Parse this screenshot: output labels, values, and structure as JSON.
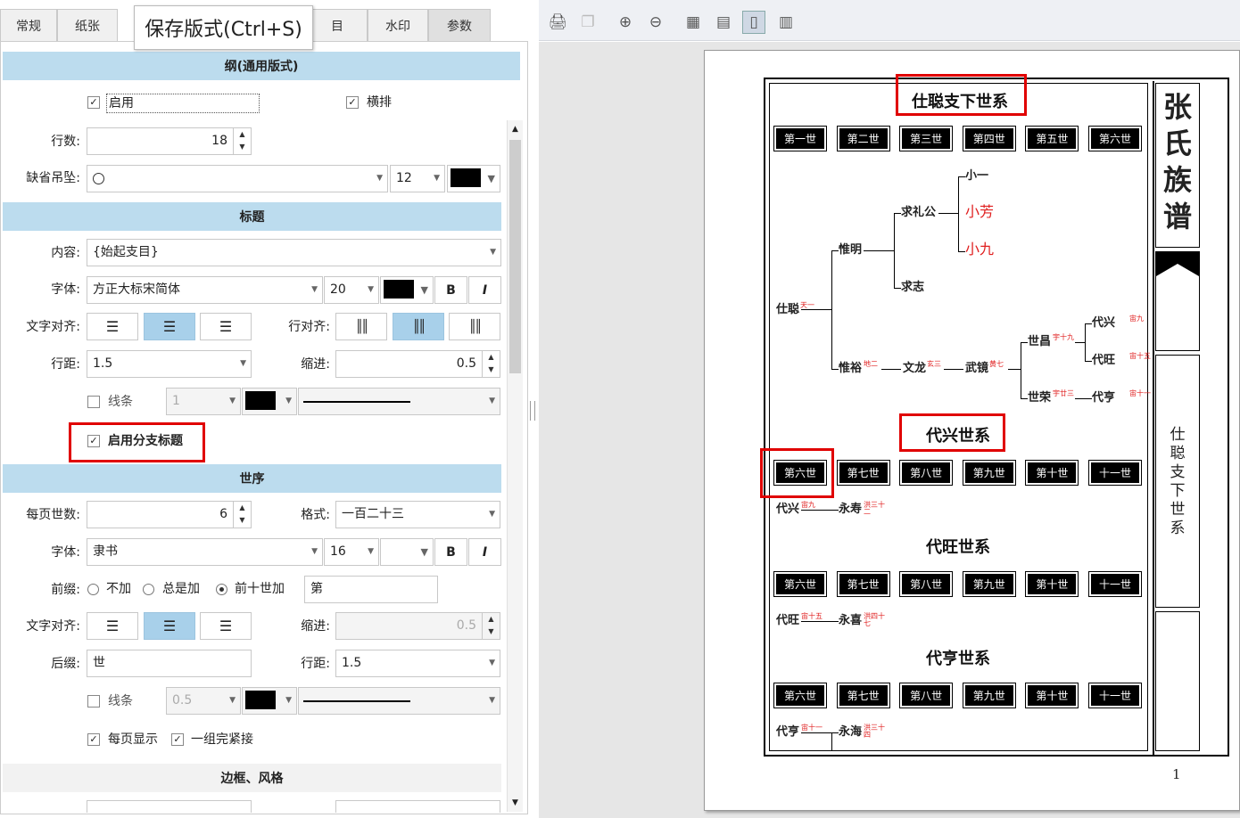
{
  "tabs": [
    {
      "label": "常规"
    },
    {
      "label": "纸张"
    },
    {
      "label": "目"
    },
    {
      "label": "水印"
    },
    {
      "label": "参数"
    }
  ],
  "tooltip": "保存版式(Ctrl+S)",
  "s1": {
    "title": "纲(通用版式)",
    "enable": "启用",
    "horizontal": "横排",
    "rows_label": "行数:",
    "rows": "18",
    "pendant_label": "缺省吊坠:",
    "pendant_size": "12"
  },
  "s2": {
    "title": "标题",
    "content_label": "内容:",
    "content": "{始起支目}",
    "font_label": "字体:",
    "font": "方正大标宋简体",
    "size": "20",
    "bold": "B",
    "italic": "I",
    "align_label": "文字对齐:",
    "row_align_label": "行对齐:",
    "spacing_label": "行距:",
    "spacing": "1.5",
    "indent_label": "缩进:",
    "indent": "0.5",
    "line_label": "线条",
    "line_value": "1",
    "branch_title": "启用分支标题"
  },
  "s3": {
    "title": "世序",
    "per_page_label": "每页世数:",
    "per_page": "6",
    "format_label": "格式:",
    "format": "一百二十三",
    "font_label": "字体:",
    "font": "隶书",
    "size": "16",
    "bold": "B",
    "italic": "I",
    "prefix_label": "前缀:",
    "opt_none": "不加",
    "opt_always": "总是加",
    "opt_first10": "前十世加",
    "prefix": "第",
    "align_label": "文字对齐:",
    "indent_label": "缩进:",
    "indent": "0.5",
    "suffix_label": "后缀:",
    "suffix": "世",
    "spacing_label": "行距:",
    "spacing": "1.5",
    "line_label": "线条",
    "line_value": "0.5",
    "show_each": "每页显示",
    "compact": "一组完紧接"
  },
  "s4": {
    "title": "边框、风格"
  },
  "doc": {
    "side_title": [
      "张",
      "氏",
      "族",
      "谱"
    ],
    "side_sub": [
      "仕",
      "聪",
      "支",
      "下",
      "世",
      "系"
    ],
    "page_num": "1",
    "sec1": "仕聪支下世系",
    "gens1": [
      "第一世",
      "第二世",
      "第三世",
      "第四世",
      "第五世",
      "第六世"
    ],
    "gens_b": [
      "第六世",
      "第七世",
      "第八世",
      "第九世",
      "第十世",
      "十一世"
    ],
    "sec2": "代兴世系",
    "sec3": "代旺世系",
    "sec4": "代亨世系",
    "names": {
      "shicong": "仕聪",
      "weiming": "惟明",
      "weiyu": "惟裕",
      "qiuli": "求礼公",
      "qiuzhi": "求志",
      "xiaoyi": "小一",
      "xiaofang": "小芳",
      "xiaojiu": "小九",
      "wenlong": "文龙",
      "wujing": "武镜",
      "shichang": "世昌",
      "shirong": "世荣",
      "daixing": "代兴",
      "daiwang": "代旺",
      "daiheng": "代亨",
      "yongshou": "永寿",
      "yongxi": "永喜",
      "yonghai": "永海"
    },
    "marks": {
      "shicong": "天一",
      "weiyu": "地二",
      "wenlong": "玄三",
      "wujing": "黄七",
      "shichang": "宇十九",
      "shirong": "宇廿三",
      "daixing": "宙九",
      "daiwang": "宙十五",
      "daiheng": "宙十一",
      "yongshou": "洪三十二",
      "yongxi": "洪四十七",
      "yonghai": "洪三十四"
    }
  },
  "colors": {
    "accent": "#bcdcee",
    "highlight": "#e00000",
    "selected": "#a8d0ea"
  }
}
